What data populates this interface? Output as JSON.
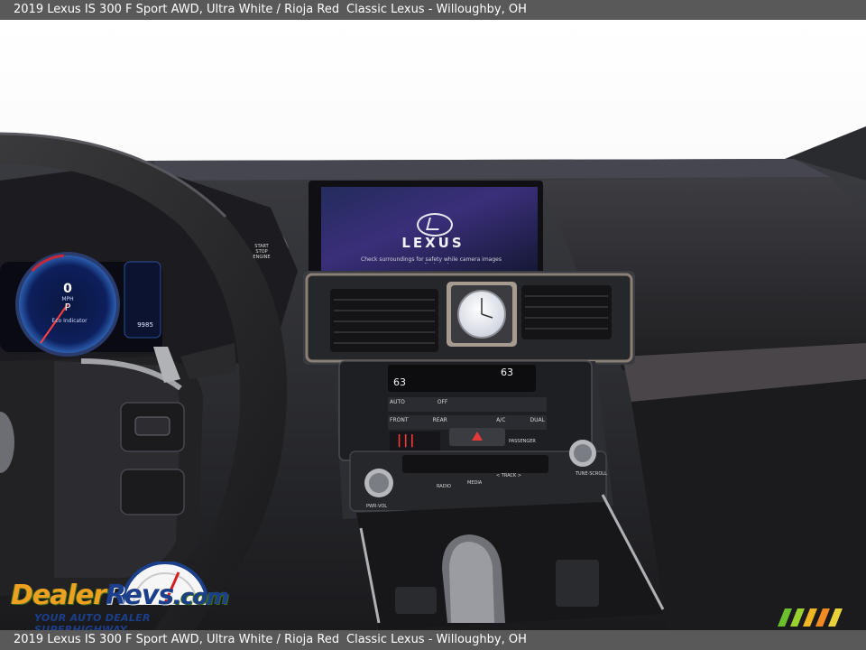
{
  "caption": {
    "vehicle": "2019 Lexus IS 300 F Sport AWD,  Ultra White / Rioja Red",
    "dealer": "Classic Lexus - Willoughby, OH"
  },
  "screen": {
    "brand": "LEXUS",
    "notice": "Check surroundings for safety while camera images are displayed."
  },
  "cluster": {
    "speed": "0",
    "unit": "MPH",
    "gear": "P",
    "eco_label": "Eco Indicator",
    "odometer": "9985"
  },
  "start_button": [
    "START",
    "STOP",
    "ENGINE"
  ],
  "climate": {
    "left_temp": "63",
    "right_temp": "63",
    "buttons_row1": [
      "AUTO",
      "OFF",
      "",
      "",
      ""
    ],
    "buttons_row2": [
      "FRONT",
      "REAR",
      "",
      "A/C",
      "DUAL"
    ],
    "passenger_label": "PASSENGER"
  },
  "audio": {
    "labels": [
      "PWR·VOL",
      "RADIO",
      "MEDIA",
      "< TRACK >",
      "TUNE·SCROLL"
    ]
  },
  "watermark": {
    "name_part1": "Dealer",
    "name_part2": "Revs",
    "name_part3": ".com",
    "tagline": "YOUR AUTO DEALER SUPERHIGHWAY"
  }
}
